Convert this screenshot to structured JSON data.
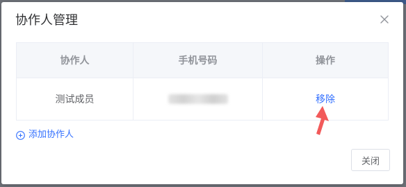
{
  "dialog": {
    "title": "协作人管理",
    "close_icon": "close-icon"
  },
  "table": {
    "headers": [
      "协作人",
      "手机号码",
      "操作"
    ],
    "rows": [
      {
        "collaborator": "测试成员",
        "phone": "",
        "action": "移除"
      }
    ]
  },
  "add_collaborator": {
    "icon": "plus-circle-icon",
    "label": "添加协作人"
  },
  "footer": {
    "close_label": "关闭"
  },
  "colors": {
    "accent": "#3370ff",
    "annotation_arrow": "#f25a5a",
    "header_bg": "#f5f7fa"
  }
}
